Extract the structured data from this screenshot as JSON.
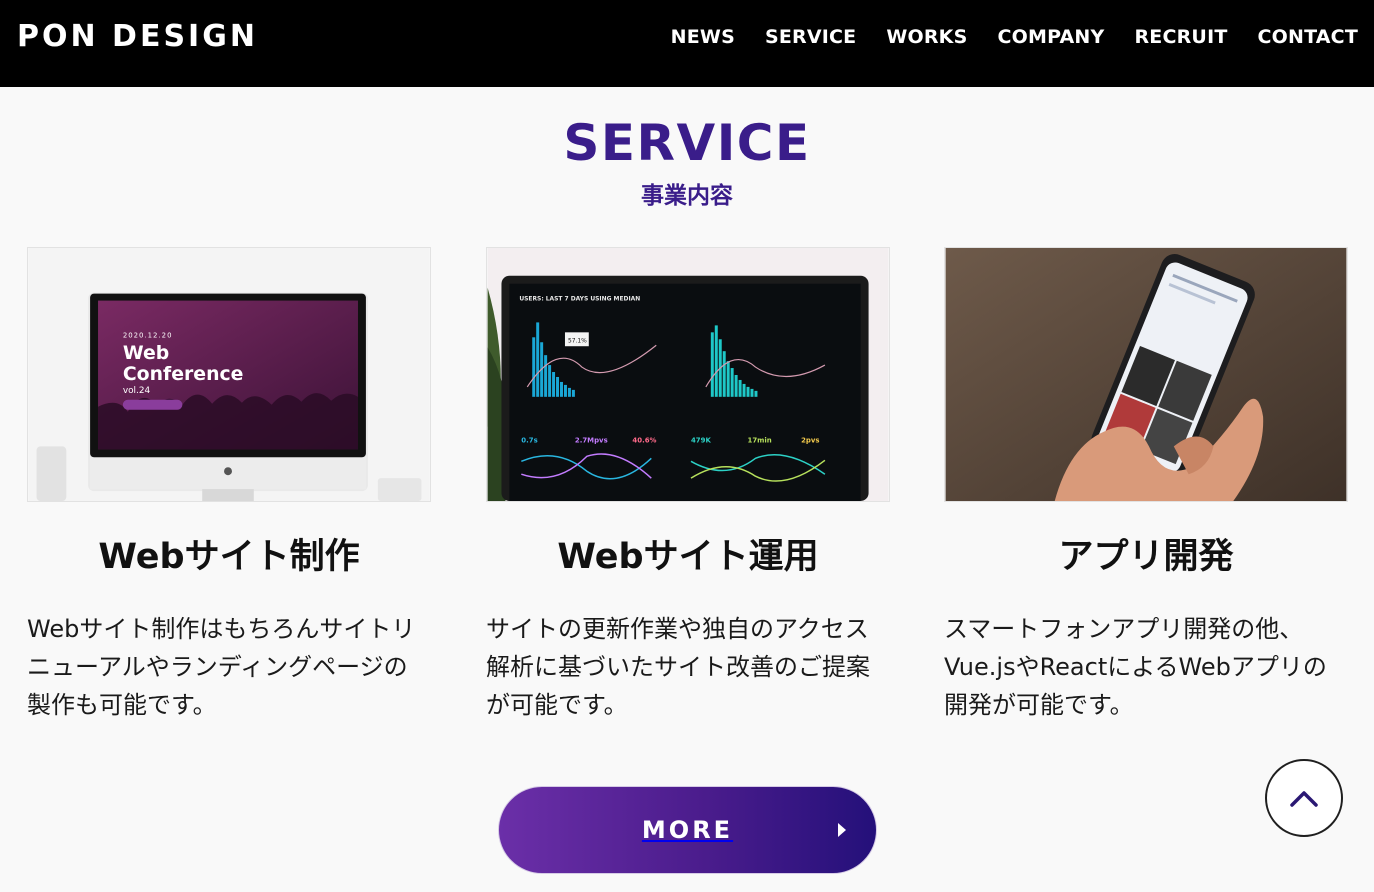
{
  "header": {
    "logo": "PON DESIGN",
    "nav": [
      "NEWS",
      "SERVICE",
      "WORKS",
      "COMPANY",
      "RECRUIT",
      "CONTACT"
    ]
  },
  "section": {
    "title": "SERVICE",
    "subtitle": "事業内容"
  },
  "cards": [
    {
      "image_alt": "web-conference-monitor",
      "image_text": {
        "date": "2020.12.20",
        "line1": "Web",
        "line2": "Conference",
        "vol": "vol.24"
      },
      "title": "Webサイト制作",
      "text": "Webサイト制作はもちろんサイトリニューアルやランディングページの製作も可能です。"
    },
    {
      "image_alt": "analytics-dashboard-laptop",
      "image_text": {
        "header": "USERS: LAST 7 DAYS USING MEDIAN",
        "pct": "57.1%",
        "v1": "0.7s",
        "v2": "2.7Mpvs",
        "v3": "40.6%",
        "v4": "479K",
        "v5": "17min",
        "v6": "2pvs"
      },
      "title": "Webサイト運用",
      "text": "サイトの更新作業や独自のアクセス解析に基づいたサイト改善のご提案が可能です。"
    },
    {
      "image_alt": "smartphone-in-hand",
      "title": "アプリ開発",
      "text": "スマートフォンアプリ開発の他、Vue.jsやReactによるWebアプリの開発が可能です。"
    }
  ],
  "more_button": {
    "label": "MORE"
  },
  "colors": {
    "accent": "#3a1d8a",
    "header_bg": "#000000",
    "button_gradient_start": "#6b2fa8",
    "button_gradient_end": "#24107a"
  }
}
